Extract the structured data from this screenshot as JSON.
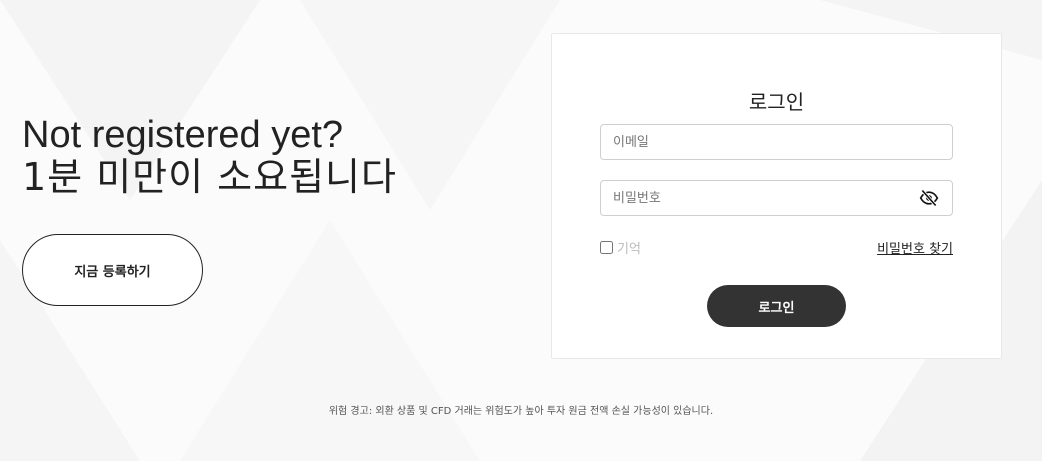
{
  "hero": {
    "headline_en": "Not registered yet?",
    "headline_ko": "1분 미만이 소요됩니다",
    "register_button": "지금 등록하기"
  },
  "login": {
    "title": "로그인",
    "email_placeholder": "이메일",
    "password_placeholder": "비밀번호",
    "password_toggle_icon": "eye-slash-icon",
    "remember_label": "기억",
    "remember_checked": false,
    "forgot_link": "비밀번호 찾기",
    "submit_label": "로그인"
  },
  "footer": {
    "risk_warning": "위험 경고: 외환 상품 및 CFD 거래는 위험도가 높아 투자 원금 전액 손실 가능성이 있습니다."
  },
  "colors": {
    "background": "#fbfbfb",
    "text": "#222222",
    "button_dark": "#333333",
    "border": "#cfcfcf"
  }
}
